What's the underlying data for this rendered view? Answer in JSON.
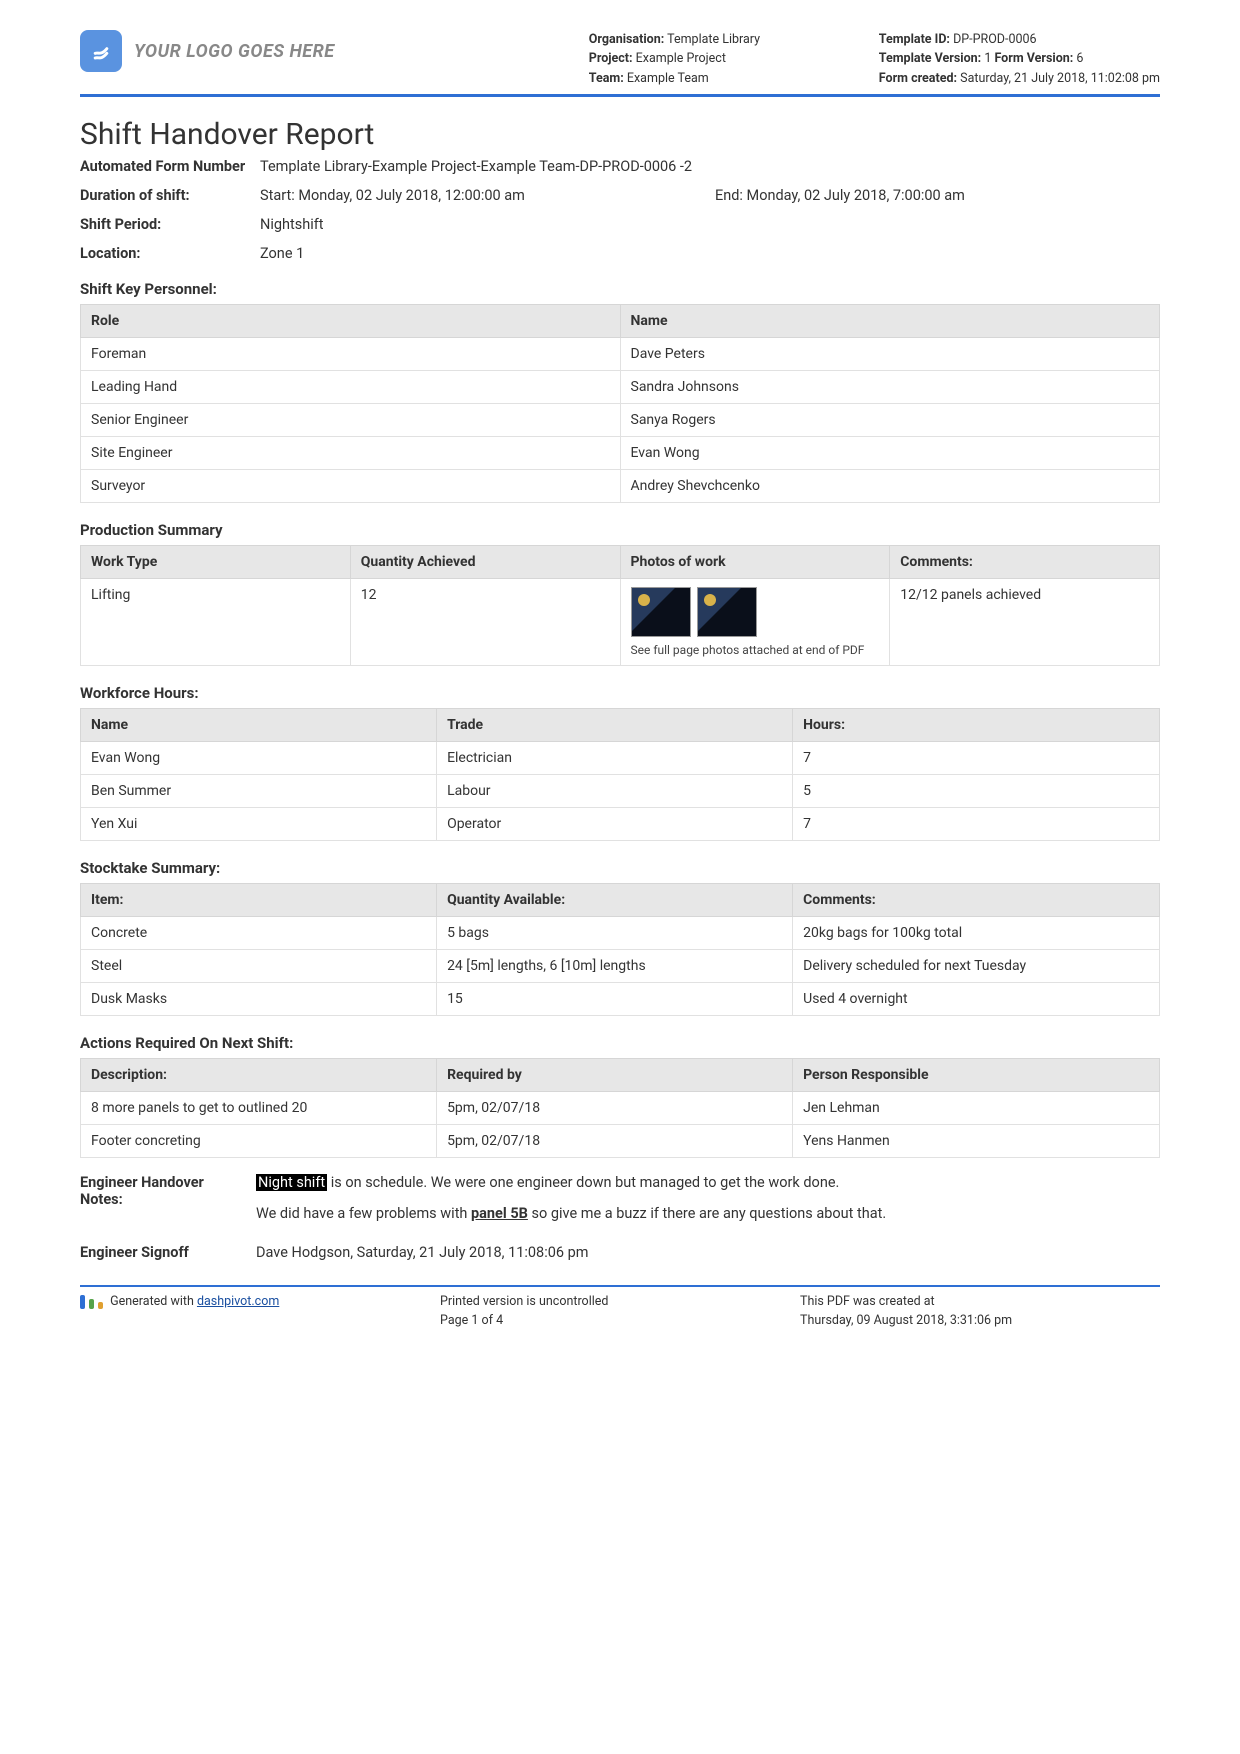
{
  "header": {
    "logo_text": "YOUR LOGO GOES HERE",
    "org_label": "Organisation:",
    "org_value": "Template Library",
    "project_label": "Project:",
    "project_value": "Example Project",
    "team_label": "Team:",
    "team_value": "Example Team",
    "template_id_label": "Template ID:",
    "template_id_value": "DP-PROD-0006",
    "template_version_label": "Template Version:",
    "template_version_value": "1",
    "form_version_label": "Form Version:",
    "form_version_value": "6",
    "form_created_label": "Form created:",
    "form_created_value": "Saturday, 21 July 2018, 11:02:08 pm"
  },
  "title": "Shift Handover Report",
  "meta": {
    "afn_label": "Automated Form Number",
    "afn_value": "Template Library-Example Project-Example Team-DP-PROD-0006   -2",
    "duration_label": "Duration of shift:",
    "duration_start": "Start: Monday, 02 July 2018, 12:00:00 am",
    "duration_end": "End: Monday, 02 July 2018, 7:00:00 am",
    "shift_period_label": "Shift Period:",
    "shift_period_value": "Nightshift",
    "location_label": "Location:",
    "location_value": "Zone 1"
  },
  "personnel": {
    "section_title": "Shift Key Personnel:",
    "headers": {
      "role": "Role",
      "name": "Name"
    },
    "rows": [
      {
        "role": "Foreman",
        "name": "Dave Peters"
      },
      {
        "role": "Leading Hand",
        "name": "Sandra Johnsons"
      },
      {
        "role": "Senior Engineer",
        "name": "Sanya Rogers"
      },
      {
        "role": "Site Engineer",
        "name": "Evan Wong"
      },
      {
        "role": "Surveyor",
        "name": "Andrey Shevchcenko"
      }
    ]
  },
  "production": {
    "section_title": "Production Summary",
    "headers": {
      "work_type": "Work Type",
      "qty": "Quantity Achieved",
      "photos": "Photos of work",
      "comments": "Comments:"
    },
    "rows": [
      {
        "work_type": "Lifting",
        "qty": "12",
        "photos_note": "See full page photos attached at end of PDF",
        "comments": "12/12 panels achieved"
      }
    ]
  },
  "workforce": {
    "section_title": "Workforce Hours:",
    "headers": {
      "name": "Name",
      "trade": "Trade",
      "hours": "Hours:"
    },
    "rows": [
      {
        "name": "Evan Wong",
        "trade": "Electrician",
        "hours": "7"
      },
      {
        "name": "Ben Summer",
        "trade": "Labour",
        "hours": "5"
      },
      {
        "name": "Yen Xui",
        "trade": "Operator",
        "hours": "7"
      }
    ]
  },
  "stocktake": {
    "section_title": "Stocktake Summary:",
    "headers": {
      "item": "Item:",
      "qty": "Quantity Available:",
      "comments": "Comments:"
    },
    "rows": [
      {
        "item": "Concrete",
        "qty": "5 bags",
        "comments": "20kg bags for 100kg total"
      },
      {
        "item": "Steel",
        "qty": "24 [5m] lengths, 6 [10m] lengths",
        "comments": "Delivery scheduled for next Tuesday"
      },
      {
        "item": "Dusk Masks",
        "qty": "15",
        "comments": "Used 4 overnight"
      }
    ]
  },
  "actions": {
    "section_title": "Actions Required On Next Shift:",
    "headers": {
      "desc": "Description:",
      "required_by": "Required by",
      "person": "Person Responsible"
    },
    "rows": [
      {
        "desc": "8 more panels to get to outlined 20",
        "required_by": "5pm, 02/07/18",
        "person": "Jen Lehman"
      },
      {
        "desc": "Footer concreting",
        "required_by": "5pm, 02/07/18",
        "person": "Yens Hanmen"
      }
    ]
  },
  "notes": {
    "label": "Engineer Handover Notes:",
    "hl1": "Night shift",
    "text1": " is on schedule. We were one engineer down but managed to get the work done.",
    "text2a": "We did have a few problems with ",
    "hl2": "panel 5B",
    "text2b": " so give me a buzz if there are any questions about that.",
    "signoff_label": "Engineer Signoff",
    "signoff_value": "Dave Hodgson, Saturday, 21 July 2018, 11:08:06 pm"
  },
  "footer": {
    "gen_prefix": "Generated with ",
    "gen_link": "dashpivot.com",
    "printed": "Printed version is uncontrolled",
    "page": "Page 1 of 4",
    "created_label": "This PDF was created at",
    "created_value": "Thursday, 09 August 2018, 3:31:06 pm"
  }
}
